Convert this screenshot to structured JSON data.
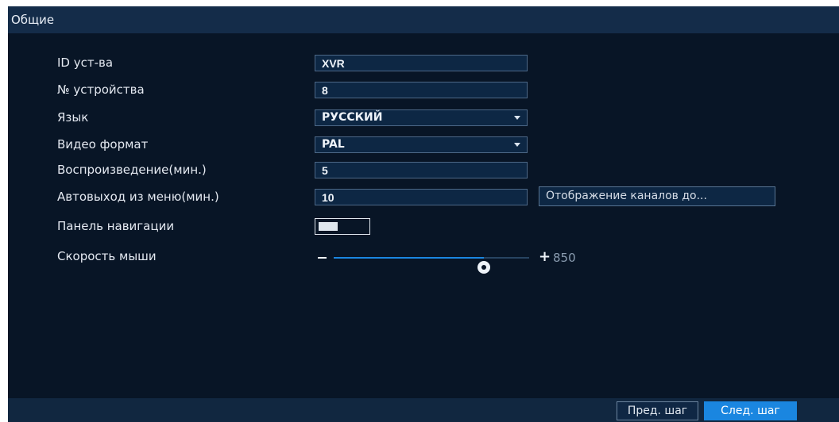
{
  "window": {
    "title": "Общие"
  },
  "fields": {
    "device_id": {
      "label": "ID уст-ва",
      "value": "XVR"
    },
    "device_no": {
      "label": "№ устройства",
      "value": "8"
    },
    "language": {
      "label": "Язык",
      "value": "РУССКИЙ"
    },
    "video_format": {
      "label": "Видео формат",
      "value": "PAL"
    },
    "playback": {
      "label": "Воспроизведение(мин.)",
      "value": "5"
    },
    "auto_logout": {
      "label": "Автовыход из меню(мин.)",
      "value": "10"
    },
    "channel_display_button": "Отображение каналов до...",
    "nav_panel": {
      "label": "Панель навигации",
      "enabled": false
    },
    "mouse_speed": {
      "label": "Скорость мыши",
      "value": "850",
      "level_fraction": 0.77
    }
  },
  "footer": {
    "prev_label": "Пред. шаг",
    "next_label": "След. шаг"
  },
  "colors": {
    "background": "#081526",
    "titlebar": "#142c49",
    "accent": "#1a86e0"
  }
}
